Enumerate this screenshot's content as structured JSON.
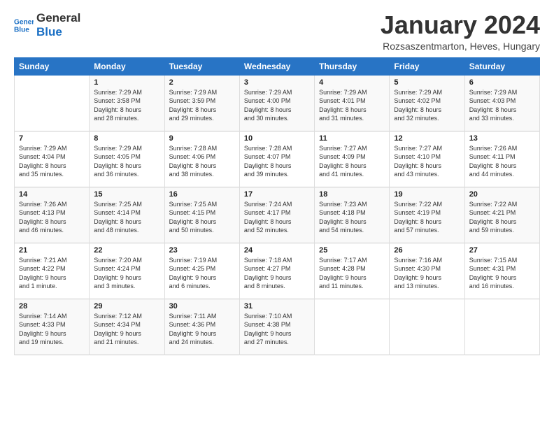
{
  "logo": {
    "line1": "General",
    "line2": "Blue"
  },
  "title": "January 2024",
  "subtitle": "Rozsaszentmarton, Heves, Hungary",
  "days_header": [
    "Sunday",
    "Monday",
    "Tuesday",
    "Wednesday",
    "Thursday",
    "Friday",
    "Saturday"
  ],
  "weeks": [
    [
      {
        "day": "",
        "content": ""
      },
      {
        "day": "1",
        "content": "Sunrise: 7:29 AM\nSunset: 3:58 PM\nDaylight: 8 hours\nand 28 minutes."
      },
      {
        "day": "2",
        "content": "Sunrise: 7:29 AM\nSunset: 3:59 PM\nDaylight: 8 hours\nand 29 minutes."
      },
      {
        "day": "3",
        "content": "Sunrise: 7:29 AM\nSunset: 4:00 PM\nDaylight: 8 hours\nand 30 minutes."
      },
      {
        "day": "4",
        "content": "Sunrise: 7:29 AM\nSunset: 4:01 PM\nDaylight: 8 hours\nand 31 minutes."
      },
      {
        "day": "5",
        "content": "Sunrise: 7:29 AM\nSunset: 4:02 PM\nDaylight: 8 hours\nand 32 minutes."
      },
      {
        "day": "6",
        "content": "Sunrise: 7:29 AM\nSunset: 4:03 PM\nDaylight: 8 hours\nand 33 minutes."
      }
    ],
    [
      {
        "day": "7",
        "content": "Sunrise: 7:29 AM\nSunset: 4:04 PM\nDaylight: 8 hours\nand 35 minutes."
      },
      {
        "day": "8",
        "content": "Sunrise: 7:29 AM\nSunset: 4:05 PM\nDaylight: 8 hours\nand 36 minutes."
      },
      {
        "day": "9",
        "content": "Sunrise: 7:28 AM\nSunset: 4:06 PM\nDaylight: 8 hours\nand 38 minutes."
      },
      {
        "day": "10",
        "content": "Sunrise: 7:28 AM\nSunset: 4:07 PM\nDaylight: 8 hours\nand 39 minutes."
      },
      {
        "day": "11",
        "content": "Sunrise: 7:27 AM\nSunset: 4:09 PM\nDaylight: 8 hours\nand 41 minutes."
      },
      {
        "day": "12",
        "content": "Sunrise: 7:27 AM\nSunset: 4:10 PM\nDaylight: 8 hours\nand 43 minutes."
      },
      {
        "day": "13",
        "content": "Sunrise: 7:26 AM\nSunset: 4:11 PM\nDaylight: 8 hours\nand 44 minutes."
      }
    ],
    [
      {
        "day": "14",
        "content": "Sunrise: 7:26 AM\nSunset: 4:13 PM\nDaylight: 8 hours\nand 46 minutes."
      },
      {
        "day": "15",
        "content": "Sunrise: 7:25 AM\nSunset: 4:14 PM\nDaylight: 8 hours\nand 48 minutes."
      },
      {
        "day": "16",
        "content": "Sunrise: 7:25 AM\nSunset: 4:15 PM\nDaylight: 8 hours\nand 50 minutes."
      },
      {
        "day": "17",
        "content": "Sunrise: 7:24 AM\nSunset: 4:17 PM\nDaylight: 8 hours\nand 52 minutes."
      },
      {
        "day": "18",
        "content": "Sunrise: 7:23 AM\nSunset: 4:18 PM\nDaylight: 8 hours\nand 54 minutes."
      },
      {
        "day": "19",
        "content": "Sunrise: 7:22 AM\nSunset: 4:19 PM\nDaylight: 8 hours\nand 57 minutes."
      },
      {
        "day": "20",
        "content": "Sunrise: 7:22 AM\nSunset: 4:21 PM\nDaylight: 8 hours\nand 59 minutes."
      }
    ],
    [
      {
        "day": "21",
        "content": "Sunrise: 7:21 AM\nSunset: 4:22 PM\nDaylight: 9 hours\nand 1 minute."
      },
      {
        "day": "22",
        "content": "Sunrise: 7:20 AM\nSunset: 4:24 PM\nDaylight: 9 hours\nand 3 minutes."
      },
      {
        "day": "23",
        "content": "Sunrise: 7:19 AM\nSunset: 4:25 PM\nDaylight: 9 hours\nand 6 minutes."
      },
      {
        "day": "24",
        "content": "Sunrise: 7:18 AM\nSunset: 4:27 PM\nDaylight: 9 hours\nand 8 minutes."
      },
      {
        "day": "25",
        "content": "Sunrise: 7:17 AM\nSunset: 4:28 PM\nDaylight: 9 hours\nand 11 minutes."
      },
      {
        "day": "26",
        "content": "Sunrise: 7:16 AM\nSunset: 4:30 PM\nDaylight: 9 hours\nand 13 minutes."
      },
      {
        "day": "27",
        "content": "Sunrise: 7:15 AM\nSunset: 4:31 PM\nDaylight: 9 hours\nand 16 minutes."
      }
    ],
    [
      {
        "day": "28",
        "content": "Sunrise: 7:14 AM\nSunset: 4:33 PM\nDaylight: 9 hours\nand 19 minutes."
      },
      {
        "day": "29",
        "content": "Sunrise: 7:12 AM\nSunset: 4:34 PM\nDaylight: 9 hours\nand 21 minutes."
      },
      {
        "day": "30",
        "content": "Sunrise: 7:11 AM\nSunset: 4:36 PM\nDaylight: 9 hours\nand 24 minutes."
      },
      {
        "day": "31",
        "content": "Sunrise: 7:10 AM\nSunset: 4:38 PM\nDaylight: 9 hours\nand 27 minutes."
      },
      {
        "day": "",
        "content": ""
      },
      {
        "day": "",
        "content": ""
      },
      {
        "day": "",
        "content": ""
      }
    ]
  ]
}
